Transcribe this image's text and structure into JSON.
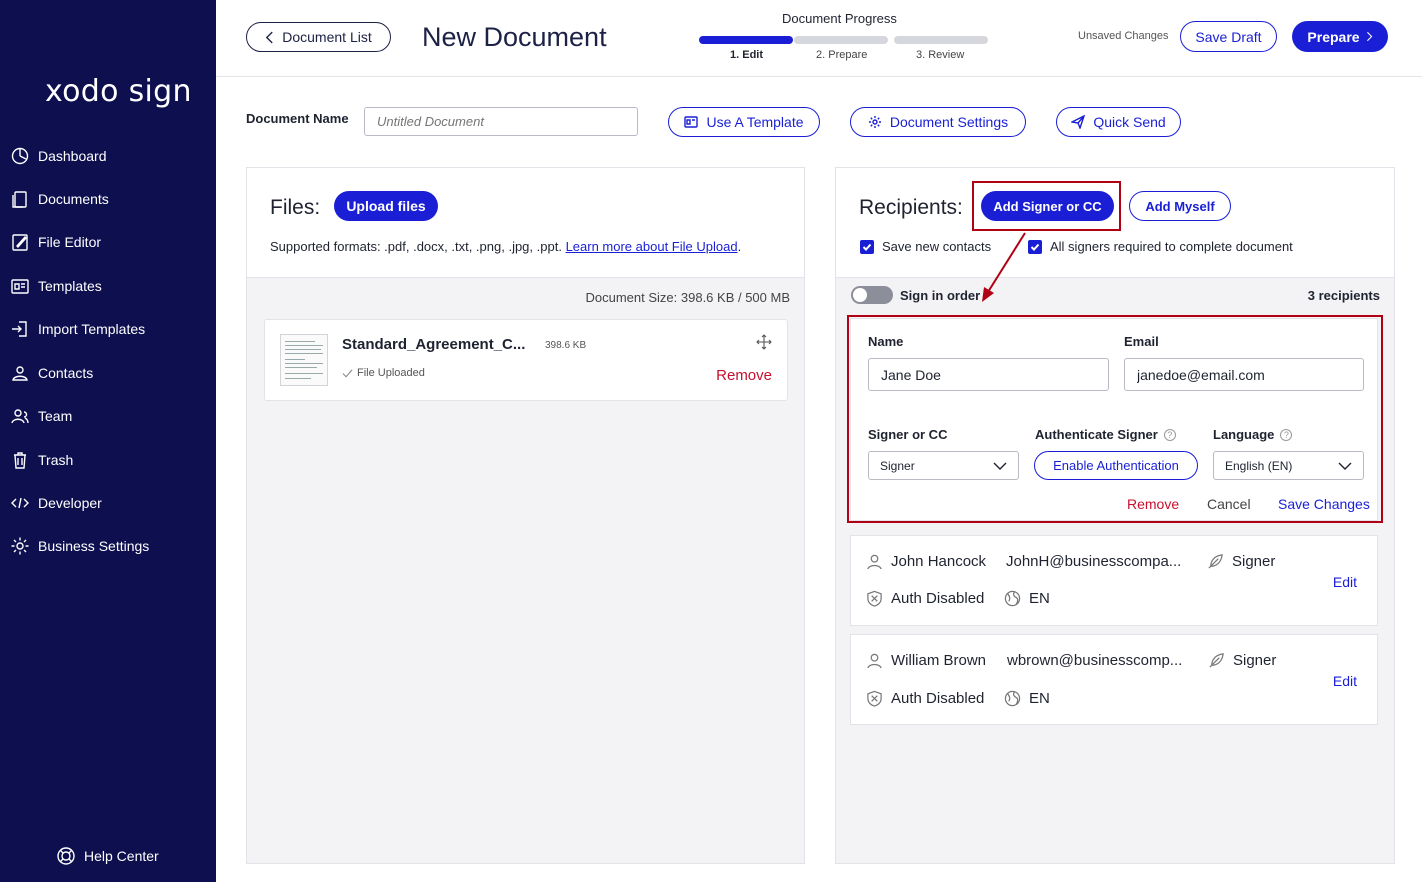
{
  "sidebar": {
    "logo": "xodo sign",
    "items": [
      {
        "label": "Dashboard",
        "icon": "dashboard-icon"
      },
      {
        "label": "Documents",
        "icon": "documents-icon"
      },
      {
        "label": "File Editor",
        "icon": "file-editor-icon"
      },
      {
        "label": "Templates",
        "icon": "templates-icon"
      },
      {
        "label": "Import Templates",
        "icon": "import-icon"
      },
      {
        "label": "Contacts",
        "icon": "contacts-icon"
      },
      {
        "label": "Team",
        "icon": "team-icon"
      },
      {
        "label": "Trash",
        "icon": "trash-icon"
      },
      {
        "label": "Developer",
        "icon": "code-icon"
      },
      {
        "label": "Business Settings",
        "icon": "gear-icon"
      }
    ],
    "help": "Help Center"
  },
  "header": {
    "back_label": "Document List",
    "title": "New Document",
    "progress_title": "Document Progress",
    "steps": [
      "1. Edit",
      "2. Prepare",
      "3. Review"
    ],
    "unsaved": "Unsaved Changes",
    "save_draft": "Save Draft",
    "prepare": "Prepare"
  },
  "docname": {
    "label": "Document Name",
    "placeholder": "Untitled Document",
    "use_template": "Use A Template",
    "settings": "Document Settings",
    "quick_send": "Quick Send"
  },
  "files": {
    "title": "Files:",
    "upload": "Upload files",
    "supported": "Supported formats: .pdf, .docx, .txt, .png, .jpg, .ppt.",
    "learn_more": "Learn more about File Upload",
    "doc_size": "Document Size: 398.6 KB / 500 MB",
    "file_name": "Standard_Agreement_C...",
    "file_size": "398.6 KB",
    "file_status": "File Uploaded",
    "remove": "Remove"
  },
  "recipients": {
    "title": "Recipients:",
    "add_signer": "Add Signer or CC",
    "add_myself": "Add Myself",
    "save_contacts": "Save new contacts",
    "all_signers": "All signers required to complete document",
    "sign_in_order": "Sign in order",
    "count": "3 recipients",
    "edit": {
      "name_label": "Name",
      "email_label": "Email",
      "name_value": "Jane Doe",
      "email_value": "janedoe@email.com",
      "signer_cc_label": "Signer or CC",
      "signer_cc_value": "Signer",
      "auth_label": "Authenticate Signer",
      "auth_button": "Enable Authentication",
      "language_label": "Language",
      "language_value": "English (EN)",
      "remove": "Remove",
      "cancel": "Cancel",
      "save": "Save Changes"
    },
    "list": [
      {
        "name": "John Hancock",
        "email": "JohnH@businesscompa...",
        "role": "Signer",
        "auth": "Auth Disabled",
        "lang": "EN",
        "edit": "Edit"
      },
      {
        "name": "William Brown",
        "email": "wbrown@businesscomp...",
        "role": "Signer",
        "auth": "Auth Disabled",
        "lang": "EN",
        "edit": "Edit"
      }
    ]
  },
  "colors": {
    "sidebar": "#0d0f4f",
    "accent": "#1a1fd6",
    "danger": "#c8102e",
    "annotation": "#b00014"
  }
}
